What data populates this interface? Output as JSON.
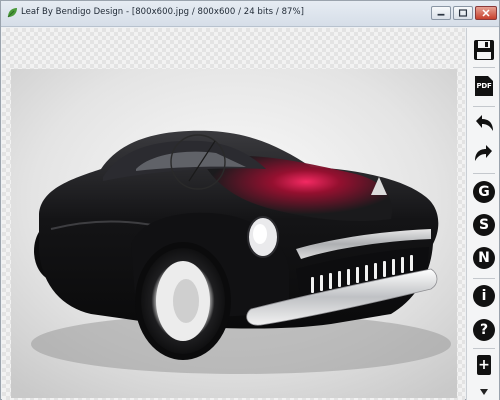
{
  "window": {
    "title": "Leaf By Bendigo Design - [800x600.jpg / 800x600 / 24 bits / 87%]",
    "minimize_icon": "minimize-icon",
    "maximize_icon": "maximize-icon",
    "close_icon": "close-icon"
  },
  "toolbar": {
    "items": [
      {
        "name": "save",
        "icon": "floppy-disk-icon"
      },
      {
        "name": "pdf",
        "icon": "pdf-icon",
        "label": "PDF"
      },
      {
        "name": "undo",
        "icon": "undo-icon"
      },
      {
        "name": "redo",
        "icon": "redo-icon"
      },
      {
        "name": "g",
        "icon": "g-circle-icon",
        "label": "G"
      },
      {
        "name": "s",
        "icon": "s-circle-icon",
        "label": "S"
      },
      {
        "name": "n",
        "icon": "n-circle-icon",
        "label": "N"
      },
      {
        "name": "info",
        "icon": "info-icon",
        "label": "i"
      },
      {
        "name": "help",
        "icon": "help-icon",
        "label": "?"
      },
      {
        "name": "add",
        "icon": "plus-icon",
        "label": "+"
      }
    ]
  },
  "image": {
    "subject": "black and red concept hot-rod car",
    "colors": {
      "body": "#1a1a1c",
      "accent": "#8a0f2a",
      "chrome": "#e8e8ea",
      "background": "#e6e6e6"
    }
  }
}
